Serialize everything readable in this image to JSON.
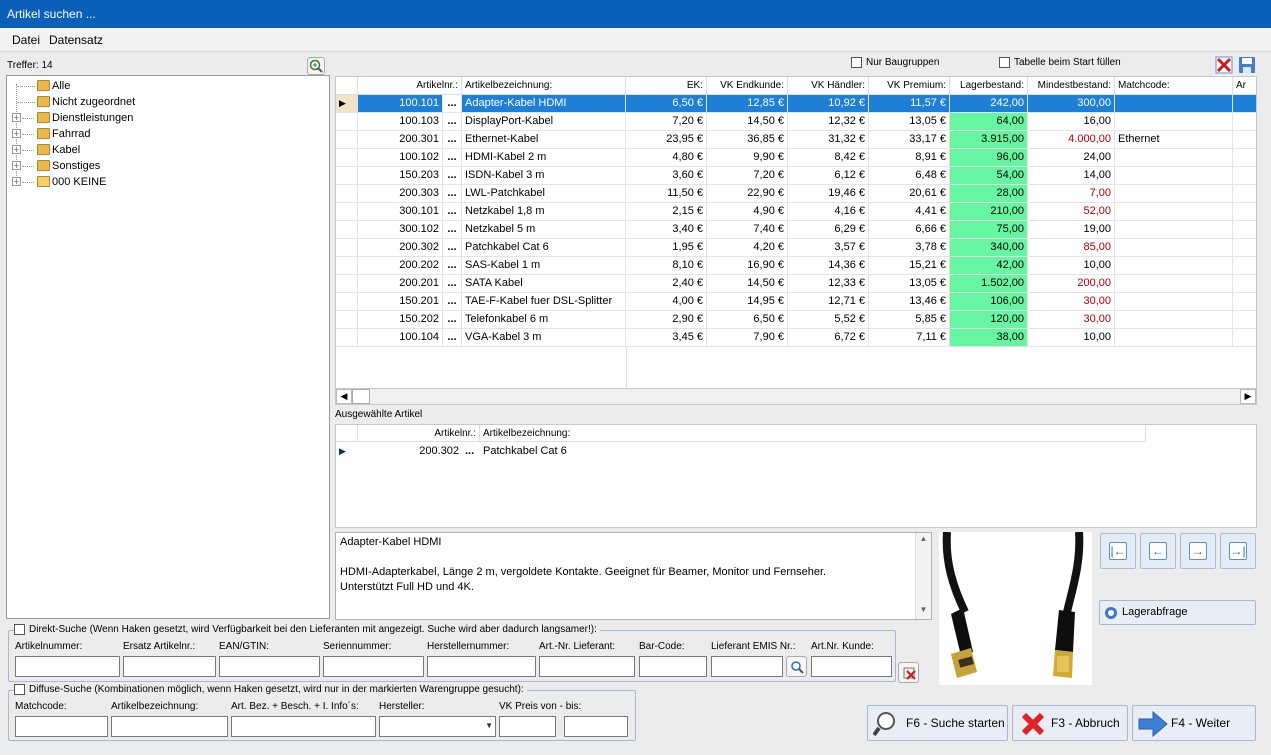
{
  "window": {
    "title": "Artikel suchen ..."
  },
  "menu": {
    "datei": "Datei",
    "datensatz": "Datensatz"
  },
  "treffer": "Treffer: 14",
  "tree": [
    {
      "label": "Alle",
      "expandable": false
    },
    {
      "label": "Nicht zugeordnet",
      "expandable": false
    },
    {
      "label": "Dienstleistungen",
      "expandable": true
    },
    {
      "label": "Fahrrad",
      "expandable": true
    },
    {
      "label": "Kabel",
      "expandable": true
    },
    {
      "label": "Sonstiges",
      "expandable": true
    },
    {
      "label": "000 KEINE",
      "expandable": true
    }
  ],
  "options": {
    "nur_baugruppen": "Nur Baugruppen",
    "tabelle_start": "Tabelle beim Start füllen"
  },
  "grid": {
    "headers": [
      "Artikelnr.:",
      "Artikelbezeichnung:",
      "EK:",
      "VK Endkunde:",
      "VK Händler:",
      "VK Premium:",
      "Lagerbestand:",
      "Mindestbestand:",
      "Matchcode:",
      "Ar"
    ],
    "ellipsis": "...",
    "rows": [
      {
        "nr": "100.101",
        "name": "Adapter-Kabel HDMI",
        "ek": "6,50 €",
        "vke": "12,85 €",
        "vkh": "10,92 €",
        "vkp": "11,57 €",
        "lager": "242,00",
        "mind": "300,00",
        "match": "",
        "mind_red": false,
        "lager_green": false,
        "selected": true
      },
      {
        "nr": "100.103",
        "name": "DisplayPort-Kabel",
        "ek": "7,20 €",
        "vke": "14,50 €",
        "vkh": "12,32 €",
        "vkp": "13,05 €",
        "lager": "64,00",
        "mind": "16,00",
        "match": "",
        "mind_red": false,
        "lager_green": true,
        "selected": false
      },
      {
        "nr": "200.301",
        "name": "Ethernet-Kabel",
        "ek": "23,95 €",
        "vke": "36,85 €",
        "vkh": "31,32 €",
        "vkp": "33,17 €",
        "lager": "3.915,00",
        "mind": "4.000,00",
        "match": "Ethernet",
        "mind_red": true,
        "lager_green": true,
        "selected": false
      },
      {
        "nr": "100.102",
        "name": "HDMI-Kabel 2 m",
        "ek": "4,80 €",
        "vke": "9,90 €",
        "vkh": "8,42 €",
        "vkp": "8,91 €",
        "lager": "96,00",
        "mind": "24,00",
        "match": "",
        "mind_red": false,
        "lager_green": true,
        "selected": false
      },
      {
        "nr": "150.203",
        "name": "ISDN-Kabel 3 m",
        "ek": "3,60 €",
        "vke": "7,20 €",
        "vkh": "6,12 €",
        "vkp": "6,48 €",
        "lager": "54,00",
        "mind": "14,00",
        "match": "",
        "mind_red": false,
        "lager_green": true,
        "selected": false
      },
      {
        "nr": "200.303",
        "name": "LWL-Patchkabel",
        "ek": "11,50 €",
        "vke": "22,90 €",
        "vkh": "19,46 €",
        "vkp": "20,61 €",
        "lager": "28,00",
        "mind": "7,00",
        "match": "",
        "mind_red": true,
        "lager_green": true,
        "selected": false
      },
      {
        "nr": "300.101",
        "name": "Netzkabel 1,8 m",
        "ek": "2,15 €",
        "vke": "4,90 €",
        "vkh": "4,16 €",
        "vkp": "4,41 €",
        "lager": "210,00",
        "mind": "52,00",
        "match": "",
        "mind_red": true,
        "lager_green": true,
        "selected": false
      },
      {
        "nr": "300.102",
        "name": "Netzkabel 5 m",
        "ek": "3,40 €",
        "vke": "7,40 €",
        "vkh": "6,29 €",
        "vkp": "6,66 €",
        "lager": "75,00",
        "mind": "19,00",
        "match": "",
        "mind_red": false,
        "lager_green": true,
        "selected": false
      },
      {
        "nr": "200.302",
        "name": "Patchkabel Cat 6",
        "ek": "1,95 €",
        "vke": "4,20 €",
        "vkh": "3,57 €",
        "vkp": "3,78 €",
        "lager": "340,00",
        "mind": "85,00",
        "match": "",
        "mind_red": true,
        "lager_green": true,
        "selected": false
      },
      {
        "nr": "200.202",
        "name": "SAS-Kabel 1 m",
        "ek": "8,10 €",
        "vke": "16,90 €",
        "vkh": "14,36 €",
        "vkp": "15,21 €",
        "lager": "42,00",
        "mind": "10,00",
        "match": "",
        "mind_red": false,
        "lager_green": true,
        "selected": false
      },
      {
        "nr": "200.201",
        "name": "SATA Kabel",
        "ek": "2,40 €",
        "vke": "14,50 €",
        "vkh": "12,33 €",
        "vkp": "13,05 €",
        "lager": "1.502,00",
        "mind": "200,00",
        "match": "",
        "mind_red": true,
        "lager_green": true,
        "selected": false
      },
      {
        "nr": "150.201",
        "name": "TAE-F-Kabel fuer DSL-Splitter",
        "ek": "4,00 €",
        "vke": "14,95 €",
        "vkh": "12,71 €",
        "vkp": "13,46 €",
        "lager": "106,00",
        "mind": "30,00",
        "match": "",
        "mind_red": true,
        "lager_green": true,
        "selected": false
      },
      {
        "nr": "150.202",
        "name": "Telefonkabel 6 m",
        "ek": "2,90 €",
        "vke": "6,50 €",
        "vkh": "5,52 €",
        "vkp": "5,85 €",
        "lager": "120,00",
        "mind": "30,00",
        "match": "",
        "mind_red": true,
        "lager_green": true,
        "selected": false
      },
      {
        "nr": "100.104",
        "name": "VGA-Kabel 3 m",
        "ek": "3,45 €",
        "vke": "7,90 €",
        "vkh": "6,72 €",
        "vkp": "7,11 €",
        "lager": "38,00",
        "mind": "10,00",
        "match": "",
        "mind_red": false,
        "lager_green": true,
        "selected": false
      }
    ]
  },
  "selected_section": {
    "title": "Ausgewählte Artikel",
    "headers": [
      "Artikelnr.:",
      "Artikelbezeichnung:"
    ],
    "rows": [
      {
        "nr": "200.302",
        "name": "Patchkabel Cat 6"
      }
    ]
  },
  "description": {
    "title": "Adapter-Kabel HDMI",
    "line1": "HDMI-Adapterkabel, Länge 2 m, vergoldete Kontakte. Geeignet für Beamer, Monitor und Fernseher.",
    "line2": "Unterstützt Full HD und 4K."
  },
  "lagerabfrage": "Lagerabfrage",
  "direkt": {
    "label": "Direkt-Suche (Wenn Haken gesetzt, wird Verfügbarkeit bei den Lieferanten mit angezeigt. Suche wird aber dadurch langsamer!):",
    "fields": [
      "Artikelnummer:",
      "Ersatz Artikelnr.:",
      "EAN/GTIN:",
      "Seriennummer:",
      "Herstellernummer:",
      "Art.-Nr. Lieferant:",
      "Bar-Code:",
      "Lieferant EMIS Nr.:",
      "Art.Nr. Kunde:"
    ]
  },
  "diffuse": {
    "label": "Diffuse-Suche (Kombinationen möglich, wenn Haken gesetzt, wird nur in der markierten Warengruppe gesucht):",
    "fields": [
      "Matchcode:",
      "Artikelbezeichnung:",
      "Art. Bez. + Besch. + I. Info´s:",
      "Hersteller:",
      "VK Preis von - bis:"
    ]
  },
  "buttons": {
    "suche": "F6 - Suche starten",
    "suche_underline": "S",
    "abbruch": "F3 - Abbruch",
    "weiter": "F4 - Weiter"
  },
  "colors": {
    "title": "#0a5fb8",
    "selection": "#1e7fd6",
    "stock_green": "#66f5a0",
    "warn_red": "#b00000"
  }
}
